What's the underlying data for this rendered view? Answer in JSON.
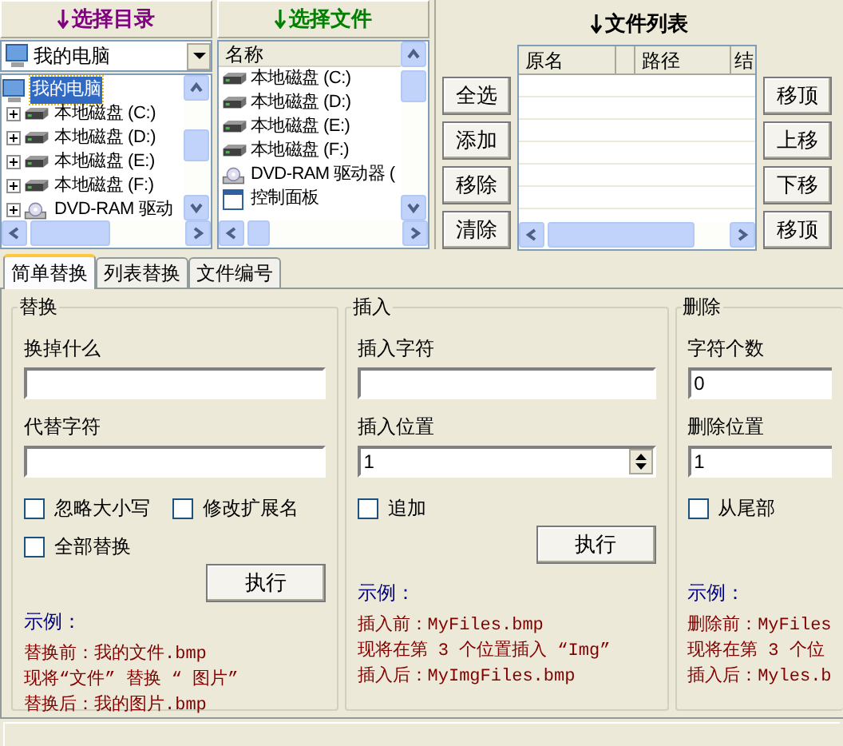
{
  "dir_panel": {
    "title": "选择目录",
    "combo_value": "我的电脑",
    "tree": [
      {
        "label": "我的电脑",
        "kind": "computer",
        "selected": true,
        "children": [
          {
            "label": "本地磁盘 (C:)",
            "kind": "disk",
            "expanded": false
          },
          {
            "label": "本地磁盘 (D:)",
            "kind": "disk",
            "expanded": false
          },
          {
            "label": "本地磁盘 (E:)",
            "kind": "disk",
            "expanded": false
          },
          {
            "label": "本地磁盘 (F:)",
            "kind": "disk",
            "expanded": false
          },
          {
            "label": "DVD-RAM 驱动",
            "kind": "dvd",
            "expanded": false
          }
        ]
      }
    ]
  },
  "file_panel": {
    "title": "选择文件",
    "column": "名称",
    "items": [
      {
        "label": "本地磁盘 (C:)",
        "kind": "disk"
      },
      {
        "label": "本地磁盘 (D:)",
        "kind": "disk"
      },
      {
        "label": "本地磁盘 (E:)",
        "kind": "disk"
      },
      {
        "label": "本地磁盘 (F:)",
        "kind": "disk"
      },
      {
        "label": "DVD-RAM 驱动器 (",
        "kind": "dvd"
      },
      {
        "label": "控制面板",
        "kind": "panel"
      }
    ]
  },
  "file_list": {
    "title": "文件列表",
    "columns": [
      "原名",
      "路径",
      "结"
    ],
    "left_buttons": [
      "全选",
      "添加",
      "移除",
      "清除"
    ],
    "right_buttons": [
      "移顶",
      "上移",
      "下移",
      "移顶"
    ]
  },
  "tabs": [
    {
      "label": "简单替换",
      "selected": true
    },
    {
      "label": "列表替换",
      "selected": false
    },
    {
      "label": "文件编号",
      "selected": false
    }
  ],
  "groups": [
    {
      "title": "替换",
      "fields": [
        {
          "label": "换掉什么",
          "kind": "text"
        },
        {
          "label": "代替字符",
          "kind": "text"
        }
      ],
      "checkboxes": [
        {
          "label": "忽略大小写",
          "checked": false
        },
        {
          "label": "修改扩展名",
          "checked": false
        },
        {
          "label": "全部替换",
          "checked": false
        }
      ],
      "button": "执行",
      "example_title": "示例：",
      "example_lines": [
        "替换前：我的文件.bmp",
        "现将“文件” 替换 “ 图片”",
        "替换后：我的图片.bmp"
      ]
    },
    {
      "title": "插入",
      "fields": [
        {
          "label": "插入字符",
          "kind": "text"
        },
        {
          "label": "插入位置",
          "kind": "spin",
          "value": "1"
        }
      ],
      "checkboxes": [
        {
          "label": "追加",
          "checked": false
        }
      ],
      "button": "执行",
      "example_title": "示例：",
      "example_lines": [
        "插入前：MyFiles.bmp",
        "现将在第 3 个位置插入 “Img”",
        "插入后：MyImgFiles.bmp"
      ]
    },
    {
      "title": "删除",
      "fields": [
        {
          "label": "字符个数",
          "kind": "text",
          "value": "0"
        },
        {
          "label": "删除位置",
          "kind": "text",
          "value": "1"
        }
      ],
      "checkboxes": [
        {
          "label": "从尾部",
          "checked": false
        }
      ],
      "example_title": "示例：",
      "example_lines": [
        "删除前：MyFiles",
        "现将在第 3 个位",
        "插入后：Myles.b"
      ]
    }
  ]
}
